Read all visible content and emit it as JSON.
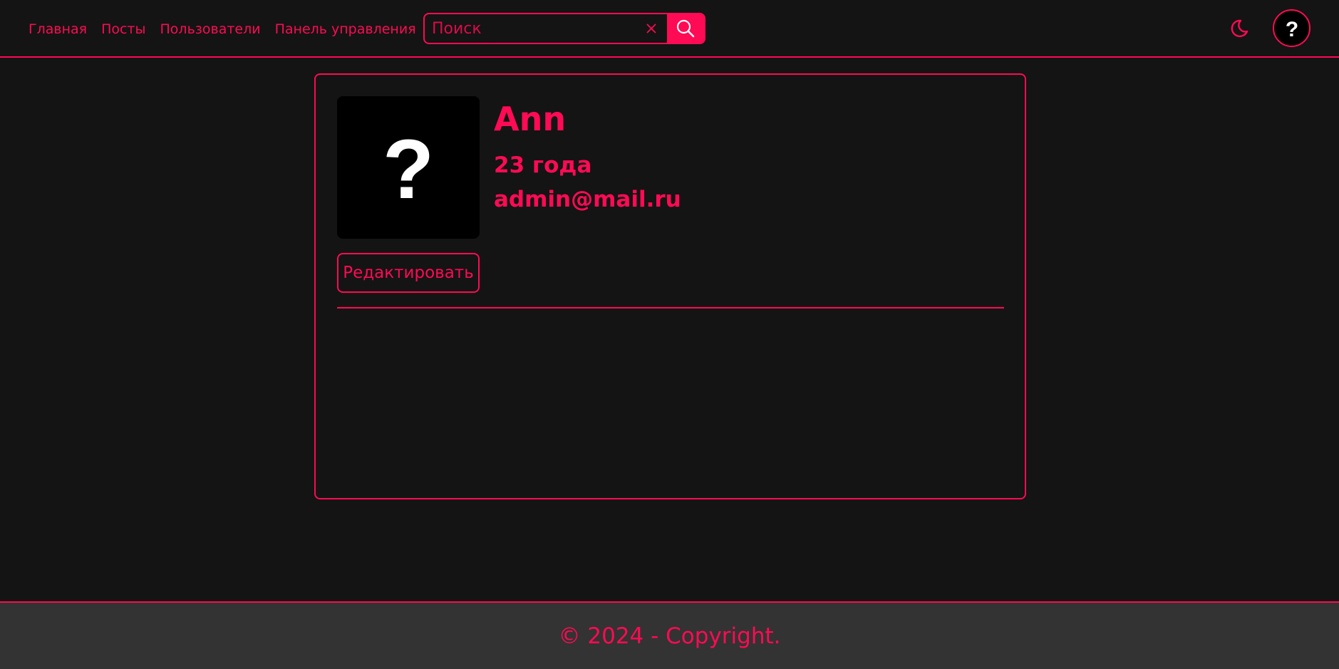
{
  "nav": {
    "items": [
      {
        "label": "Главная"
      },
      {
        "label": "Посты"
      },
      {
        "label": "Пользователи"
      },
      {
        "label": "Панель управления"
      }
    ]
  },
  "search": {
    "placeholder": "Поиск",
    "value": ""
  },
  "header": {
    "theme_icon": "moon-icon",
    "help_icon": "question-mark-icon",
    "help_label": "?"
  },
  "profile": {
    "avatar_placeholder": "?",
    "name": "Ann",
    "age": "23 года",
    "email": "admin@mail.ru",
    "edit_label": "Редактировать"
  },
  "footer": {
    "copyright": "© 2024 - Copyright."
  },
  "colors": {
    "accent": "#ff0a54",
    "background": "#141414",
    "footer_background": "#333333"
  }
}
